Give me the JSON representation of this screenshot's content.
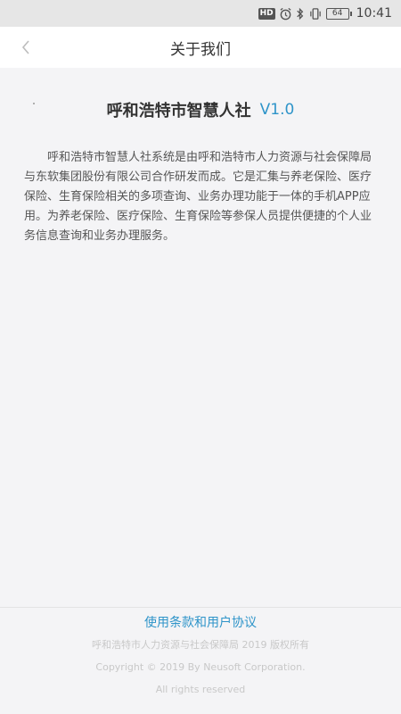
{
  "status_bar": {
    "hd_label": "HD",
    "battery_level": "64",
    "time": "10:41"
  },
  "nav": {
    "title": "关于我们"
  },
  "app": {
    "name": "呼和浩特市智慧人社",
    "version": "V1.0"
  },
  "description": "呼和浩特市智慧人社系统是由呼和浩特市人力资源与社会保障局与东软集团股份有限公司合作研发而成。它是汇集与养老保险、医疗保险、生育保险相关的多项查询、业务办理功能于一体的手机APP应用。为养老保险、医疗保险、生育保险等参保人员提供便捷的个人业务信息查询和业务办理服务。",
  "footer": {
    "terms_link": "使用条款和用户协议",
    "copyright_cn": "呼和浩特市人力资源与社会保障局 2019 版权所有",
    "copyright_en": "Copyright © 2019 By Neusoft Corporation.",
    "rights": "All rights reserved"
  },
  "colors": {
    "accent": "#2e94c9",
    "background": "#f4f4f6",
    "status_bar": "#e6e6e6"
  }
}
